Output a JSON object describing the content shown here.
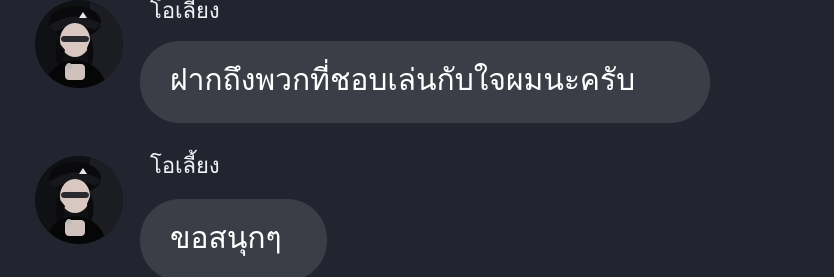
{
  "messages": [
    {
      "sender": "โอเลี้ยง",
      "text": "ฝากถึงพวกที่ชอบเล่นกับใจผมนะครับ"
    },
    {
      "sender": "โอเลี้ยง",
      "text": "ขอสนุกๆ"
    }
  ],
  "colors": {
    "background": "#22252f",
    "bubble": "#3b3e46",
    "text": "#ffffff"
  }
}
